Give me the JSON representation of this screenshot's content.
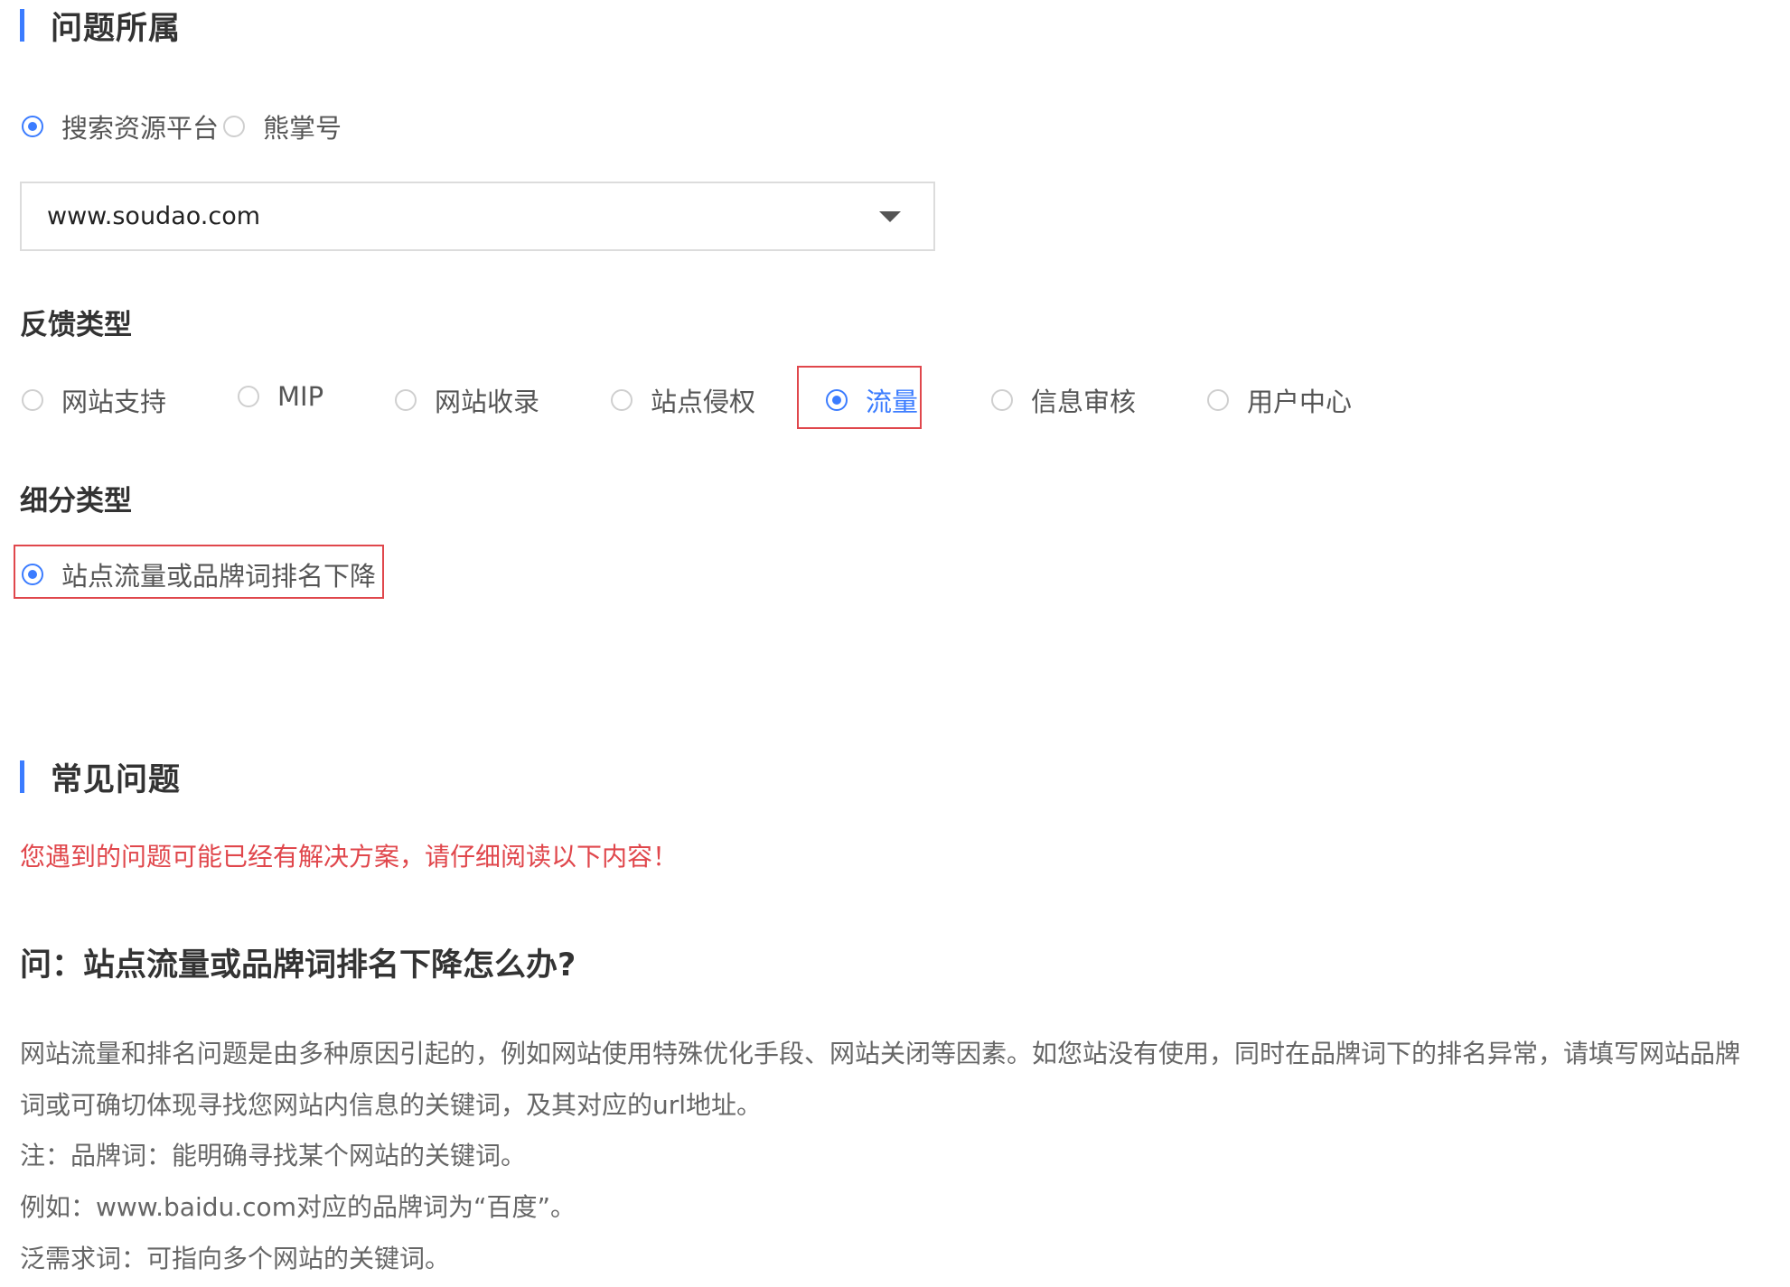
{
  "section_belong": {
    "title": "问题所属"
  },
  "platform": {
    "options": [
      {
        "label": "搜索资源平台",
        "checked": true
      },
      {
        "label": "熊掌号",
        "checked": false
      }
    ]
  },
  "site_select": {
    "value": "www.soudao.com"
  },
  "feedback_type": {
    "label": "反馈类型",
    "options": [
      {
        "label": "网站支持",
        "checked": false
      },
      {
        "label": "MIP",
        "checked": false
      },
      {
        "label": "网站收录",
        "checked": false
      },
      {
        "label": "站点侵权",
        "checked": false
      },
      {
        "label": "流量",
        "checked": true
      },
      {
        "label": "信息审核",
        "checked": false
      },
      {
        "label": "用户中心",
        "checked": false
      }
    ]
  },
  "sub_type": {
    "label": "细分类型",
    "options": [
      {
        "label": "站点流量或品牌词排名下降",
        "checked": true
      }
    ]
  },
  "faq": {
    "title": "常见问题",
    "notice": "您遇到的问题可能已经有解决方案，请仔细阅读以下内容！",
    "question": "问：站点流量或品牌词排名下降怎么办?",
    "answer_lines": [
      "网站流量和排名问题是由多种原因引起的，例如网站使用特殊优化手段、网站关闭等因素。如您站没有使用，同时在品牌词下的排名异常，请填写网站品牌",
      "词或可确切体现寻找您网站内信息的关键词，及其对应的url地址。",
      "注：品牌词：能明确寻找某个网站的关键词。",
      "例如：www.baidu.com对应的品牌词为“百度”。",
      "泛需求词：可指向多个网站的关键词。"
    ]
  },
  "colors": {
    "accent": "#3b7cff",
    "highlight": "#e0474c",
    "notice": "#e0474c"
  }
}
